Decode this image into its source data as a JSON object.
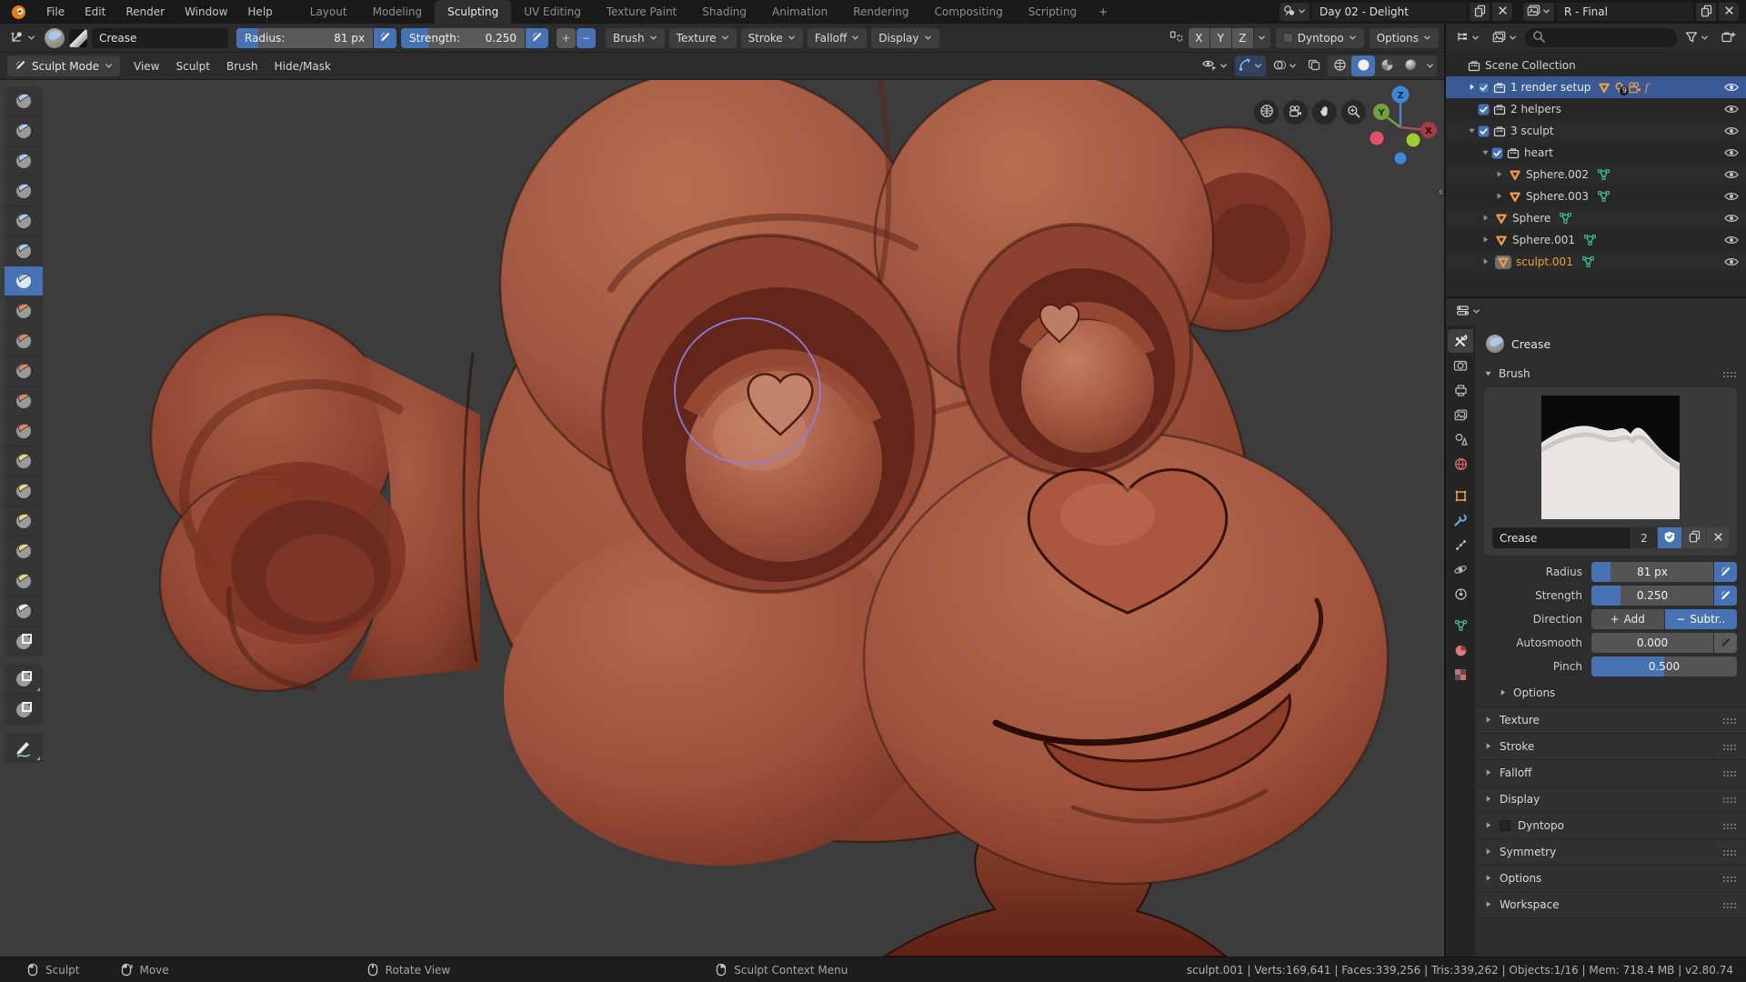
{
  "topbar": {
    "menus": [
      "File",
      "Edit",
      "Render",
      "Window",
      "Help"
    ],
    "workspace_tabs": [
      "Layout",
      "Modeling",
      "Sculpting",
      "UV Editing",
      "Texture Paint",
      "Shading",
      "Animation",
      "Rendering",
      "Compositing",
      "Scripting"
    ],
    "active_tab": "Sculpting",
    "new_workspace_label": "+",
    "scene_name": "Day 02 - Delight",
    "view_layer_name": "R - Final"
  },
  "tool_settings": {
    "brush_name": "Crease",
    "radius_label": "Radius:",
    "radius_value": "81 px",
    "radius_fill": 0.16,
    "strength_label": "Strength:",
    "strength_value": "0.250",
    "strength_fill": 0.22,
    "add_label": "+",
    "subtract_label": "−",
    "dropdowns": [
      "Brush",
      "Texture",
      "Stroke",
      "Falloff",
      "Display"
    ],
    "symmetry_axes": [
      "X",
      "Y",
      "Z"
    ],
    "dyntopo_label": "Dyntopo",
    "options_label": "Options"
  },
  "viewport": {
    "mode_selector": "Sculpt Mode",
    "menus": [
      "View",
      "Sculpt",
      "Brush",
      "Hide/Mask"
    ],
    "gizmo_axes": {
      "x": "X",
      "y": "Y",
      "z": "Z"
    },
    "brush_cursor_radius_px": 81
  },
  "toolbar": {
    "brushes": [
      "Draw",
      "Clay",
      "Clay Strips",
      "Layer",
      "Inflate",
      "Blob",
      "Crease",
      "Smooth",
      "Flatten",
      "Scrape",
      "Fill",
      "Pinch",
      "Grab",
      "Snake Hook",
      "Thumb",
      "Nudge",
      "Rotate",
      "Simplify",
      "Mask",
      "Box Mask",
      "Box Hide",
      "Annotate"
    ],
    "active_brush": "Crease"
  },
  "outliner": {
    "rows": [
      {
        "label": "Scene Collection",
        "indent": 0,
        "icon": "collection",
        "eye": false
      },
      {
        "label": "1 render setup",
        "indent": 1,
        "expand": "right",
        "checkbox": true,
        "icon": "collection",
        "selected": true,
        "badges": [
          "mesh",
          "light",
          "camera",
          "fcurve"
        ],
        "light_count": "9",
        "eye": true
      },
      {
        "label": "2 helpers",
        "indent": 1,
        "checkbox": true,
        "icon": "collection",
        "eye": true
      },
      {
        "label": "3 sculpt",
        "indent": 1,
        "expand": "down",
        "checkbox": true,
        "icon": "collection",
        "eye": true
      },
      {
        "label": "heart",
        "indent": 2,
        "expand": "down",
        "checkbox": true,
        "icon": "collection",
        "eye": true
      },
      {
        "label": "Sphere.002",
        "indent": 3,
        "expand": "right",
        "icon": "mesh",
        "data_icon": true,
        "eye": true
      },
      {
        "label": "Sphere.003",
        "indent": 3,
        "expand": "right",
        "icon": "mesh",
        "data_icon": true,
        "eye": true
      },
      {
        "label": "Sphere",
        "indent": 2,
        "expand": "right",
        "icon": "mesh",
        "data_icon": true,
        "eye": true
      },
      {
        "label": "Sphere.001",
        "indent": 2,
        "expand": "right",
        "icon": "mesh",
        "data_icon": true,
        "eye": true
      },
      {
        "label": "sculpt.001",
        "indent": 2,
        "expand": "right",
        "icon": "mesh",
        "data_icon": true,
        "eye": true,
        "active": true
      }
    ]
  },
  "properties": {
    "tabs": [
      "tool",
      "render",
      "output",
      "view-layer",
      "scene",
      "world",
      "object",
      "modifiers",
      "particles",
      "physics",
      "constraints",
      "object-data",
      "material",
      "texture"
    ],
    "active_tab": "tool",
    "header_title": "Crease",
    "brush_panel_title": "Brush",
    "brush_name": "Crease",
    "users_count": "2",
    "settings": [
      {
        "label": "Radius",
        "value": "81 px",
        "fill": 0.16,
        "pen": "on"
      },
      {
        "label": "Strength",
        "value": "0.250",
        "fill": 0.24,
        "pen": "on"
      },
      {
        "label": "Direction",
        "type": "segmented",
        "options": [
          "Add",
          "Subtr.."
        ],
        "signs": [
          "+",
          "−"
        ],
        "active_index": 1
      },
      {
        "label": "Autosmooth",
        "value": "0.000",
        "fill": 0,
        "pen": "off"
      },
      {
        "label": "Pinch",
        "value": "0.500",
        "fill": 0.5
      }
    ],
    "subsection_label": "Options",
    "collapsed_panels": [
      {
        "title": "Texture"
      },
      {
        "title": "Stroke"
      },
      {
        "title": "Falloff"
      },
      {
        "title": "Display"
      },
      {
        "title": "Dyntopo",
        "checkbox": true
      },
      {
        "title": "Symmetry"
      },
      {
        "title": "Options"
      },
      {
        "title": "Workspace"
      }
    ]
  },
  "status_bar": {
    "hints": [
      {
        "button": "left",
        "label": "Sculpt"
      },
      {
        "button": "left-drag",
        "label": "Move"
      },
      {
        "button": "middle",
        "label": "Rotate View"
      },
      {
        "button": "right",
        "label": "Sculpt Context Menu"
      }
    ],
    "stats": "sculpt.001 | Verts:169,641 | Faces:339,256 | Tris:339,262 | Objects:1/16 | Mem: 718.4 MB | v2.80.74"
  },
  "colors": {
    "accent_blue": "#4772b3",
    "selection_blue": "#3a5a96",
    "active_orange": "#efa13a",
    "clay_base": "#9c4f3a",
    "viewport_bg": "#3c3c3c"
  }
}
